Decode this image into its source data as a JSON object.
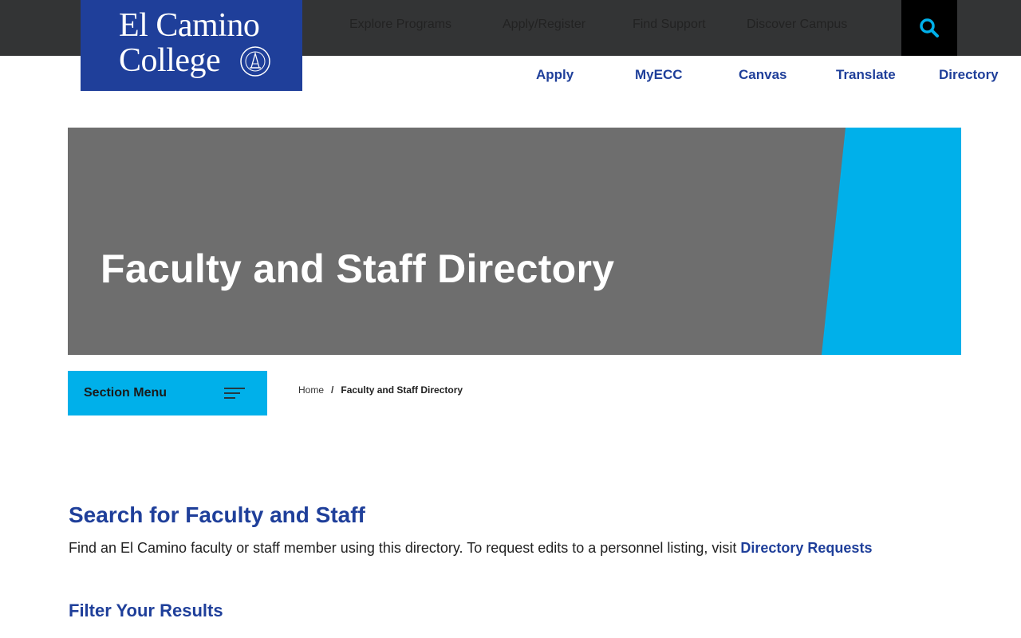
{
  "logo": {
    "line1": "El Camino",
    "line2": "College"
  },
  "main_nav": {
    "items": [
      {
        "label": "Explore Programs"
      },
      {
        "label": "Apply/Register"
      },
      {
        "label": "Find Support"
      },
      {
        "label": "Discover Campus"
      }
    ],
    "search_icon": "search-icon"
  },
  "quick_links": [
    {
      "label": "Apply"
    },
    {
      "label": "MyECC"
    },
    {
      "label": "Canvas"
    },
    {
      "label": "Translate"
    },
    {
      "label": "Directory"
    }
  ],
  "hero": {
    "title": "Faculty and Staff Directory"
  },
  "section_menu": {
    "label": "Section Menu",
    "icon": "hamburger-icon"
  },
  "breadcrumb": {
    "home": "Home",
    "separator": "/",
    "current": "Faculty and Staff Directory"
  },
  "content": {
    "heading": "Search for Faculty and Staff",
    "intro_text": "Find an El Camino faculty or staff member using this directory. To request edits to a personnel listing, visit ",
    "intro_link": "Directory Requests",
    "filter_heading": "Filter Your Results"
  },
  "colors": {
    "brand_blue": "#1f3f9a",
    "accent_cyan": "#00b0ea",
    "topbar_dark": "#333435",
    "hero_gray": "#6e6e6e"
  }
}
